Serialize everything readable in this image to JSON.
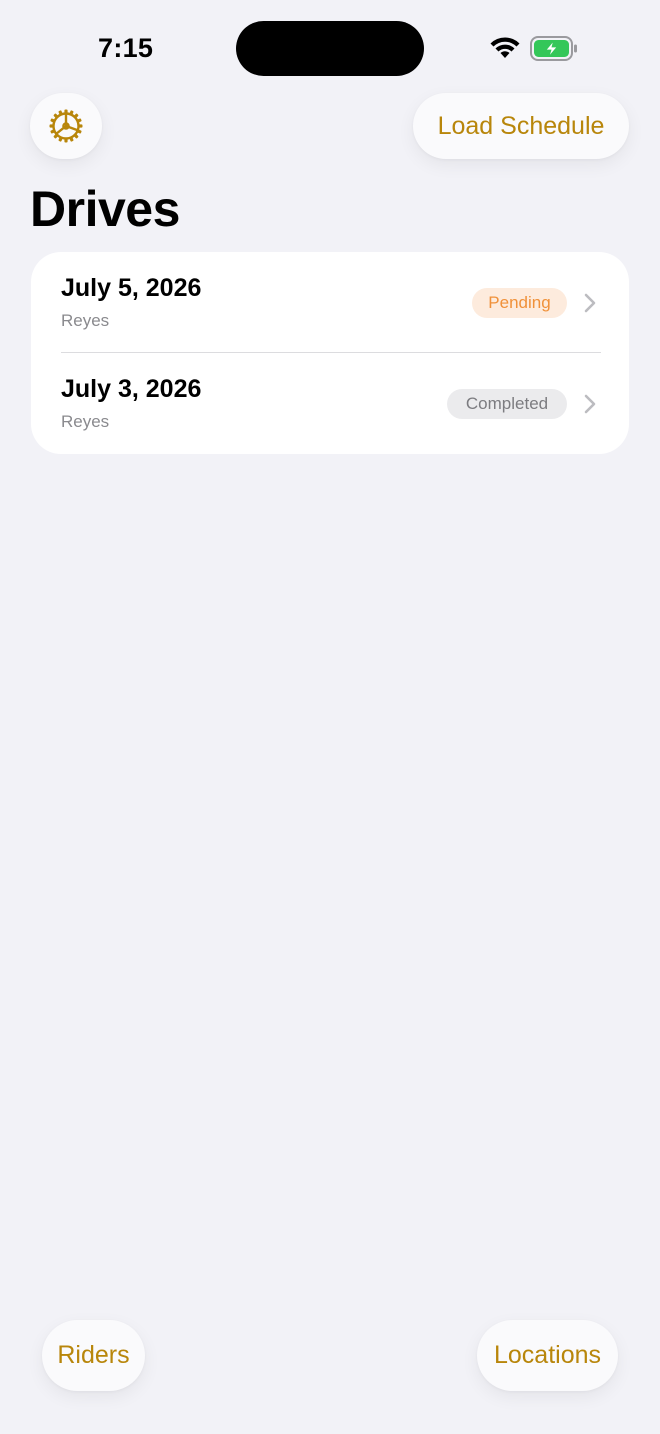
{
  "status_bar": {
    "time": "7:15"
  },
  "toolbar": {
    "settings_icon": "gear-icon",
    "load_schedule_label": "Load Schedule"
  },
  "page": {
    "title": "Drives"
  },
  "drives": [
    {
      "date": "July 5, 2026",
      "subtitle": "Reyes",
      "status": "Pending"
    },
    {
      "date": "July 3, 2026",
      "subtitle": "Reyes",
      "status": "Completed"
    }
  ],
  "bottom_bar": {
    "riders_label": "Riders",
    "locations_label": "Locations"
  },
  "colors": {
    "accent": "#b8860b",
    "pending_text": "#f0913a",
    "pending_bg": "#fdebdd",
    "completed_text": "#7c7c80",
    "completed_bg": "#ebebed",
    "battery": "#34c759"
  }
}
